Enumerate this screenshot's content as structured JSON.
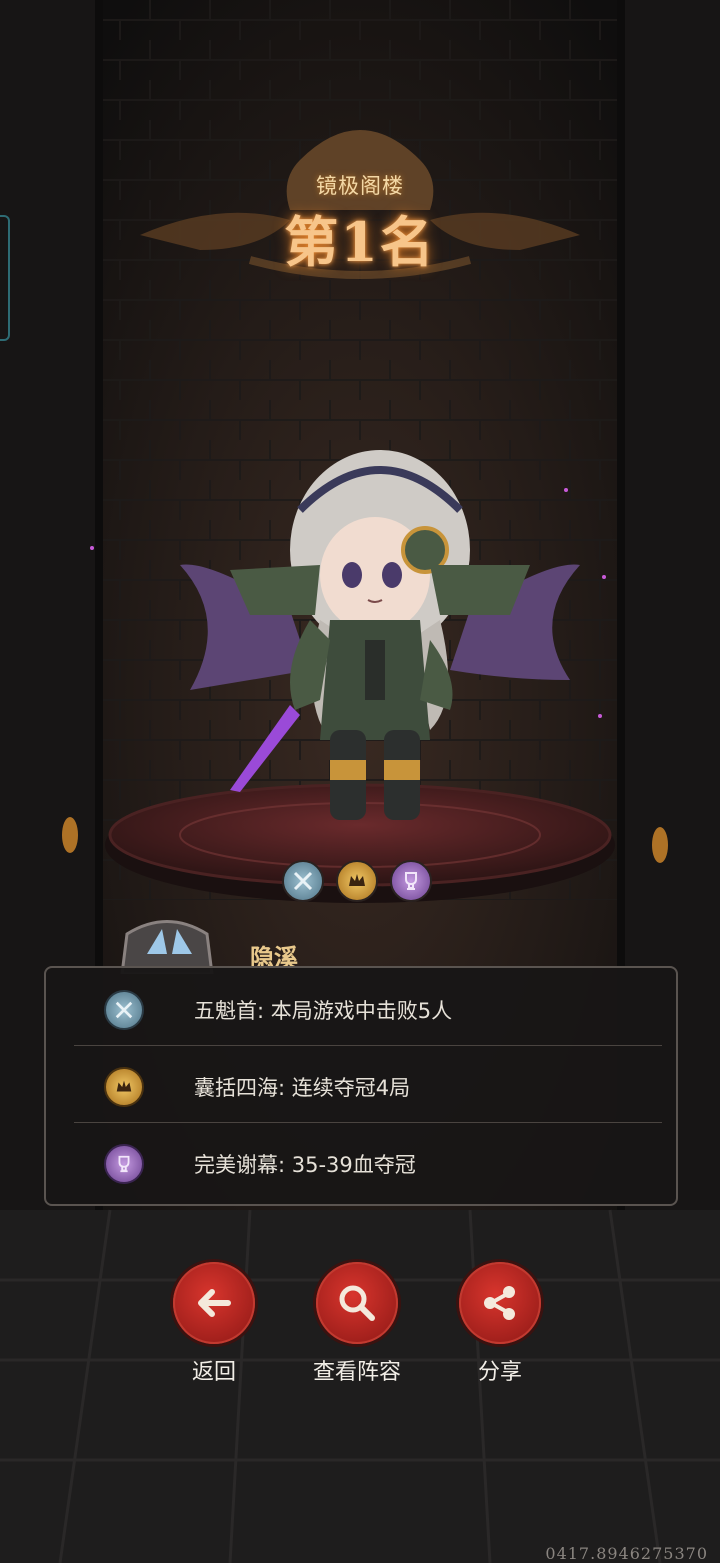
{
  "header": {
    "subtitle": "镜极阁楼",
    "rank": "第1名"
  },
  "player": {
    "name": "隐溪"
  },
  "badges": [
    {
      "icon": "crossed-swords-icon",
      "color": "#6f93a6"
    },
    {
      "icon": "crown-icon",
      "color": "#c99536"
    },
    {
      "icon": "trophy-icon",
      "color": "#8b5fb1"
    }
  ],
  "achievements": [
    {
      "icon": "crossed-swords-icon",
      "text": "五魁首: 本局游戏中击败5人"
    },
    {
      "icon": "crown-icon",
      "text": "囊括四海: 连续夺冠4局"
    },
    {
      "icon": "trophy-icon",
      "text": "完美谢幕: 35-39血夺冠"
    }
  ],
  "actions": {
    "back": "返回",
    "view_lineup": "查看阵容",
    "share": "分享"
  },
  "footer": {
    "id": "0417.8946275370"
  },
  "colors": {
    "accent_red": "#c22a24",
    "gold": "#f7c58a"
  }
}
